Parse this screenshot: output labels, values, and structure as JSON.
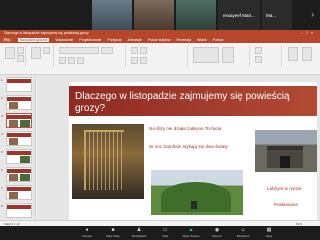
{
  "zoom": {
    "participants": [
      {
        "name": ""
      },
      {
        "name": ""
      },
      {
        "name": ""
      },
      {
        "name": "essayeef Mari..."
      },
      {
        "name": "Ma..."
      }
    ],
    "toolbar": [
      {
        "label": "Unmute",
        "icon": "microphone-icon"
      },
      {
        "label": "Start Video",
        "icon": "video-camera-icon"
      },
      {
        "label": "Participants",
        "icon": "participants-icon"
      },
      {
        "label": "Chat",
        "icon": "chat-icon"
      },
      {
        "label": "Share Screen",
        "icon": "share-screen-icon"
      },
      {
        "label": "Record",
        "icon": "record-icon"
      },
      {
        "label": "Reactions",
        "icon": "reactions-icon"
      },
      {
        "label": "Apps",
        "icon": "apps-icon"
      }
    ]
  },
  "ppt": {
    "window_title": "Dlaczego w listopadzie zajmujemy się powieścią grozy",
    "tabs": [
      "Plik",
      "Narzędzia główne",
      "Wstawianie",
      "Projektowanie",
      "Przejścia",
      "Animacje",
      "Pokaz slajdów",
      "Recenzja",
      "Widok",
      "Pomoc"
    ],
    "slide": {
      "title": "Dlaczego w listopadzie zajmujemy się powieścią grozy?",
      "text1": "Na ślizy nie działa zaklęcie To-faola",
      "text2": "W noc Samhain stykają się dwa światy",
      "text3": "Labirynt w rzezie",
      "text4": "Posłaniania"
    },
    "status": {
      "slide_no": "Slajd 3 z 12",
      "zoom": "63%"
    }
  }
}
